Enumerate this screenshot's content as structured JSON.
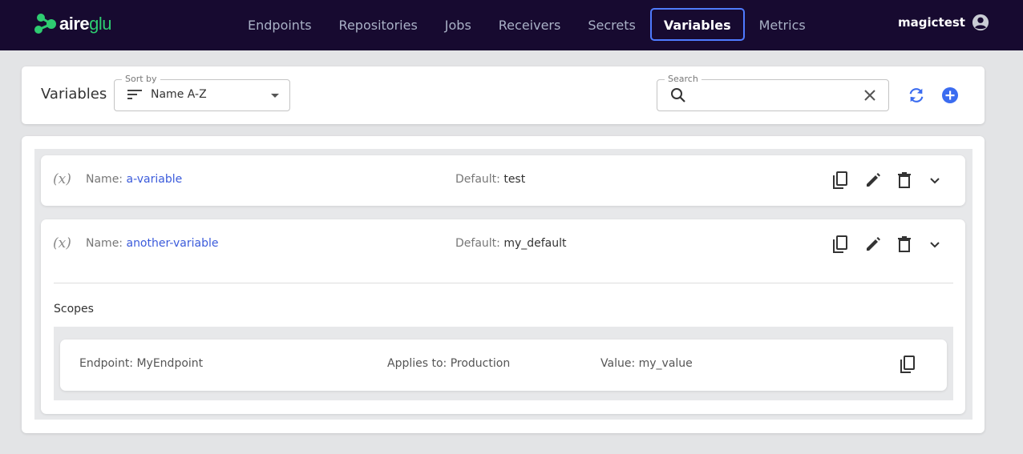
{
  "brand": {
    "name_part1": "aire",
    "name_part2": "glu"
  },
  "nav": {
    "items": [
      {
        "label": "Endpoints"
      },
      {
        "label": "Repositories"
      },
      {
        "label": "Jobs"
      },
      {
        "label": "Receivers"
      },
      {
        "label": "Secrets"
      },
      {
        "label": "Variables",
        "active": true
      },
      {
        "label": "Metrics"
      }
    ]
  },
  "user": {
    "name": "magictest"
  },
  "header": {
    "title": "Variables",
    "sort": {
      "legend": "Sort by",
      "value": "Name A-Z"
    },
    "search": {
      "legend": "Search",
      "value": ""
    }
  },
  "variables": [
    {
      "name_label": "Name:",
      "name": "a-variable",
      "default_label": "Default:",
      "default": "test",
      "expanded": false
    },
    {
      "name_label": "Name:",
      "name": "another-variable",
      "default_label": "Default:",
      "default": "my_default",
      "expanded": true,
      "scopes_title": "Scopes",
      "scopes": [
        {
          "endpoint": "Endpoint: MyEndpoint",
          "applies_to": "Applies to: Production",
          "value": "Value: my_value"
        }
      ]
    }
  ],
  "colors": {
    "topbar": "#170a30",
    "accent": "#3b5bdb",
    "brand_green": "#2ecc71",
    "active_border": "#4f7bff"
  }
}
